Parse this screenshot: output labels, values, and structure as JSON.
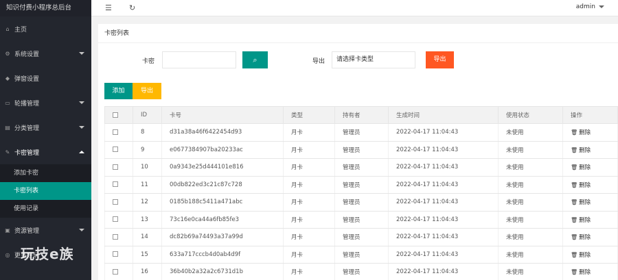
{
  "app": {
    "title": "知识付费小程序总后台"
  },
  "sidebar": {
    "items": [
      {
        "label": "主页",
        "icon": "home-icon",
        "has_caret": false
      },
      {
        "label": "系统设置",
        "icon": "gear-icon",
        "has_caret": true
      },
      {
        "label": "弹窗设置",
        "icon": "popup-icon",
        "has_caret": false
      },
      {
        "label": "轮播管理",
        "icon": "carousel-icon",
        "has_caret": true
      },
      {
        "label": "分类管理",
        "icon": "category-icon",
        "has_caret": true
      },
      {
        "label": "卡密管理",
        "icon": "edit-icon",
        "has_caret": true,
        "open": true
      }
    ],
    "subitems": [
      {
        "label": "添加卡密",
        "active": false
      },
      {
        "label": "卡密列表",
        "active": true
      },
      {
        "label": "使用记录",
        "active": false
      }
    ],
    "after": [
      {
        "label": "资源管理",
        "icon": "resource-icon",
        "has_caret": true
      },
      {
        "label": "更多好玩",
        "icon": "more-icon",
        "has_caret": false
      }
    ]
  },
  "topbar": {
    "user": "admin"
  },
  "panel": {
    "title": "卡密列表"
  },
  "search": {
    "card_label": "卡密",
    "card_value": "",
    "export_label": "导出",
    "type_select": "请选择卡类型",
    "export_button": "导出"
  },
  "actions": {
    "add": "添加",
    "export": "导出"
  },
  "table": {
    "headers": [
      "ID",
      "卡号",
      "类型",
      "持有者",
      "生成时间",
      "使用状态",
      "操作"
    ],
    "rows": [
      {
        "id": "8",
        "card": "d31a38a46f6422454d93",
        "type": "月卡",
        "holder": "管理员",
        "time": "2022-04-17 11:04:43",
        "status": "未使用",
        "op": "删除"
      },
      {
        "id": "9",
        "card": "e0677384907ba20233ac",
        "type": "月卡",
        "holder": "管理员",
        "time": "2022-04-17 11:04:43",
        "status": "未使用",
        "op": "删除"
      },
      {
        "id": "10",
        "card": "0a9343e25d444101e816",
        "type": "月卡",
        "holder": "管理员",
        "time": "2022-04-17 11:04:43",
        "status": "未使用",
        "op": "删除"
      },
      {
        "id": "11",
        "card": "00db822ed3c21c87c728",
        "type": "月卡",
        "holder": "管理员",
        "time": "2022-04-17 11:04:43",
        "status": "未使用",
        "op": "删除"
      },
      {
        "id": "12",
        "card": "0185b188c5411a471abc",
        "type": "月卡",
        "holder": "管理员",
        "time": "2022-04-17 11:04:43",
        "status": "未使用",
        "op": "删除"
      },
      {
        "id": "13",
        "card": "73c16e0ca44a6fb85fe3",
        "type": "月卡",
        "holder": "管理员",
        "time": "2022-04-17 11:04:43",
        "status": "未使用",
        "op": "删除"
      },
      {
        "id": "14",
        "card": "dc82b69a74493a37a99d",
        "type": "月卡",
        "holder": "管理员",
        "time": "2022-04-17 11:04:43",
        "status": "未使用",
        "op": "删除"
      },
      {
        "id": "15",
        "card": "633a717cccb4d0ab4d9f",
        "type": "月卡",
        "holder": "管理员",
        "time": "2022-04-17 11:04:43",
        "status": "未使用",
        "op": "删除"
      },
      {
        "id": "16",
        "card": "36b40b2a32a2c6731d1b",
        "type": "月卡",
        "holder": "管理员",
        "time": "2022-04-17 11:04:43",
        "status": "未使用",
        "op": "删除"
      }
    ]
  },
  "watermark": "玩技e族",
  "colors": {
    "sidebar": "#23262e",
    "accent": "#009688",
    "danger": "#ff5722",
    "warn": "#ffb800"
  }
}
